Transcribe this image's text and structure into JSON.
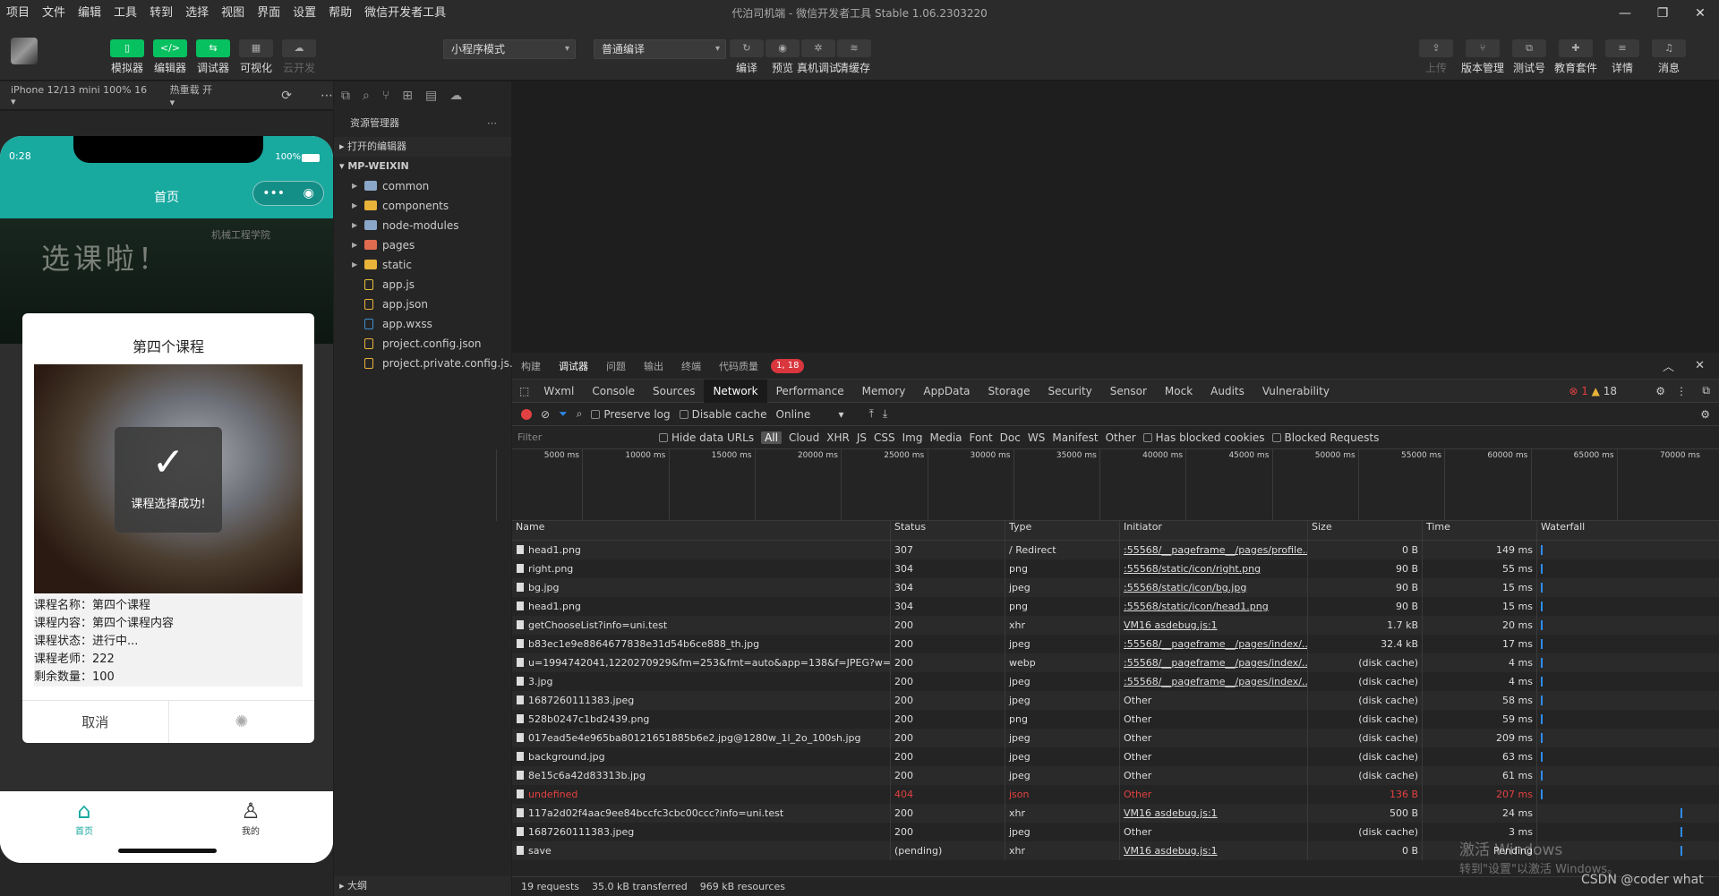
{
  "menu": [
    "项目",
    "文件",
    "编辑",
    "工具",
    "转到",
    "选择",
    "视图",
    "界面",
    "设置",
    "帮助",
    "微信开发者工具"
  ],
  "window_title": "代泊司机端 - 微信开发者工具 Stable 1.06.2303220",
  "toolbar": {
    "left": [
      {
        "icon": "▯",
        "label": "模拟器"
      },
      {
        "icon": "</>",
        "label": "编辑器"
      },
      {
        "icon": "⇆",
        "label": "调试器"
      },
      {
        "icon": "▦",
        "label": "可视化"
      },
      {
        "icon": "☁",
        "label": "云开发"
      }
    ],
    "mode": "小程序模式",
    "compile": "普通编译",
    "mid": [
      {
        "icon": "↻",
        "label": "编译"
      },
      {
        "icon": "◉",
        "label": "预览"
      },
      {
        "icon": "✲",
        "label": "真机调试"
      },
      {
        "icon": "≋",
        "label": "清缓存"
      }
    ],
    "right": [
      {
        "icon": "⇪",
        "label": "上传"
      },
      {
        "icon": "⑂",
        "label": "版本管理"
      },
      {
        "icon": "⧉",
        "label": "测试号"
      },
      {
        "icon": "✚",
        "label": "教育套件"
      },
      {
        "icon": "≡",
        "label": "详情"
      },
      {
        "icon": "♫",
        "label": "消息"
      }
    ]
  },
  "sim": {
    "device": "iPhone 12/13 mini 100% 16 ▾",
    "hot": "热重载 开 ▾"
  },
  "phone": {
    "time": "0:28",
    "battery": "100%",
    "title": "首页",
    "banner_text": "选课啦！",
    "school": "机械工程学院",
    "modal_title": "第四个课程",
    "toast": "课程选择成功!",
    "info": [
      "课程名称：第四个课程",
      "课程内容：第四个课程内容",
      "课程状态：进行中...",
      "课程老师：222",
      "剩余数量：100"
    ],
    "cancel": "取消",
    "tabs": [
      "首页",
      "我的"
    ]
  },
  "explorer": {
    "title": "资源管理器",
    "open_editors": "打开的编辑器",
    "project": "MP-WEIXIN",
    "items": [
      {
        "name": "common",
        "type": "folder"
      },
      {
        "name": "components",
        "type": "folder-y"
      },
      {
        "name": "node-modules",
        "type": "folder"
      },
      {
        "name": "pages",
        "type": "folder-r"
      },
      {
        "name": "static",
        "type": "folder-y"
      },
      {
        "name": "app.js",
        "type": "js"
      },
      {
        "name": "app.json",
        "type": "json"
      },
      {
        "name": "app.wxss",
        "type": "wxss"
      },
      {
        "name": "project.config.json",
        "type": "json"
      },
      {
        "name": "project.private.config.js...",
        "type": "json"
      }
    ],
    "outline": "大纲"
  },
  "devtools": {
    "top_tabs": [
      "构建",
      "调试器",
      "问题",
      "输出",
      "终端",
      "代码质量"
    ],
    "badge": "1, 18",
    "panels": [
      "Wxml",
      "Console",
      "Sources",
      "Network",
      "Performance",
      "Memory",
      "AppData",
      "Storage",
      "Security",
      "Sensor",
      "Mock",
      "Audits",
      "Vulnerability"
    ],
    "errors": "1",
    "warnings": "18",
    "ctrl": {
      "preserve": "Preserve log",
      "disable": "Disable cache",
      "online": "Online"
    },
    "filter": {
      "placeholder": "Filter",
      "hide": "Hide data URLs",
      "types": [
        "All",
        "Cloud",
        "XHR",
        "JS",
        "CSS",
        "Img",
        "Media",
        "Font",
        "Doc",
        "WS",
        "Manifest",
        "Other"
      ],
      "blocked_cookies": "Has blocked cookies",
      "blocked_req": "Blocked Requests"
    },
    "ticks": [
      "5000 ms",
      "10000 ms",
      "15000 ms",
      "20000 ms",
      "25000 ms",
      "30000 ms",
      "35000 ms",
      "40000 ms",
      "45000 ms",
      "50000 ms",
      "55000 ms",
      "60000 ms",
      "65000 ms",
      "70000 ms"
    ],
    "cols": [
      "Name",
      "Status",
      "Type",
      "Initiator",
      "Size",
      "Time",
      "Waterfall"
    ],
    "rows": [
      [
        "head1.png",
        "307",
        "/ Redirect",
        ":55568/__pageframe__/pages/profile...",
        "0 B",
        "149 ms"
      ],
      [
        "right.png",
        "304",
        "png",
        ":55568/static/icon/right.png",
        "90 B",
        "55 ms"
      ],
      [
        "bg.jpg",
        "304",
        "jpeg",
        ":55568/static/icon/bg.jpg",
        "90 B",
        "15 ms"
      ],
      [
        "head1.png",
        "304",
        "png",
        ":55568/static/icon/head1.png",
        "90 B",
        "15 ms"
      ],
      [
        "getChooseList?info=uni.test",
        "200",
        "xhr",
        "VM16 asdebug.js:1",
        "1.7 kB",
        "20 ms"
      ],
      [
        "b83ec1e9e8864677838e31d54b6ce888_th.jpg",
        "200",
        "jpeg",
        ":55568/__pageframe__/pages/index/...",
        "32.4 kB",
        "17 ms"
      ],
      [
        "u=1994742041,1220270929&fm=253&fmt=auto&app=138&f=JPEG?w=...",
        "200",
        "webp",
        ":55568/__pageframe__/pages/index/...",
        "(disk cache)",
        "4 ms"
      ],
      [
        "3.jpg",
        "200",
        "jpeg",
        ":55568/__pageframe__/pages/index/...",
        "(disk cache)",
        "4 ms"
      ],
      [
        "1687260111383.jpeg",
        "200",
        "jpeg",
        "Other",
        "(disk cache)",
        "58 ms"
      ],
      [
        "528b0247c1bd2439.png",
        "200",
        "png",
        "Other",
        "(disk cache)",
        "59 ms"
      ],
      [
        "017ead5e4e965ba80121651885b6e2.jpg@1280w_1l_2o_100sh.jpg",
        "200",
        "jpeg",
        "Other",
        "(disk cache)",
        "209 ms"
      ],
      [
        "background.jpg",
        "200",
        "jpeg",
        "Other",
        "(disk cache)",
        "63 ms"
      ],
      [
        "8e15c6a42d83313b.jpg",
        "200",
        "jpeg",
        "Other",
        "(disk cache)",
        "61 ms"
      ],
      [
        "undefined",
        "404",
        "json",
        "Other",
        "136 B",
        "207 ms"
      ],
      [
        "117a2d02f4aac9ee84bccfc3cbc00ccc?info=uni.test",
        "200",
        "xhr",
        "VM16 asdebug.js:1",
        "500 B",
        "24 ms"
      ],
      [
        "1687260111383.jpeg",
        "200",
        "jpeg",
        "Other",
        "(disk cache)",
        "3 ms"
      ],
      [
        "save",
        "(pending)",
        "xhr",
        "VM16 asdebug.js:1",
        "0 B",
        "Pending"
      ]
    ],
    "summary": [
      "19 requests",
      "35.0 kB transferred",
      "969 kB resources"
    ]
  },
  "watermark": {
    "win1": "激活 Windows",
    "win2": "转到\"设置\"以激活 Windows。",
    "csdn": "CSDN @coder what"
  }
}
